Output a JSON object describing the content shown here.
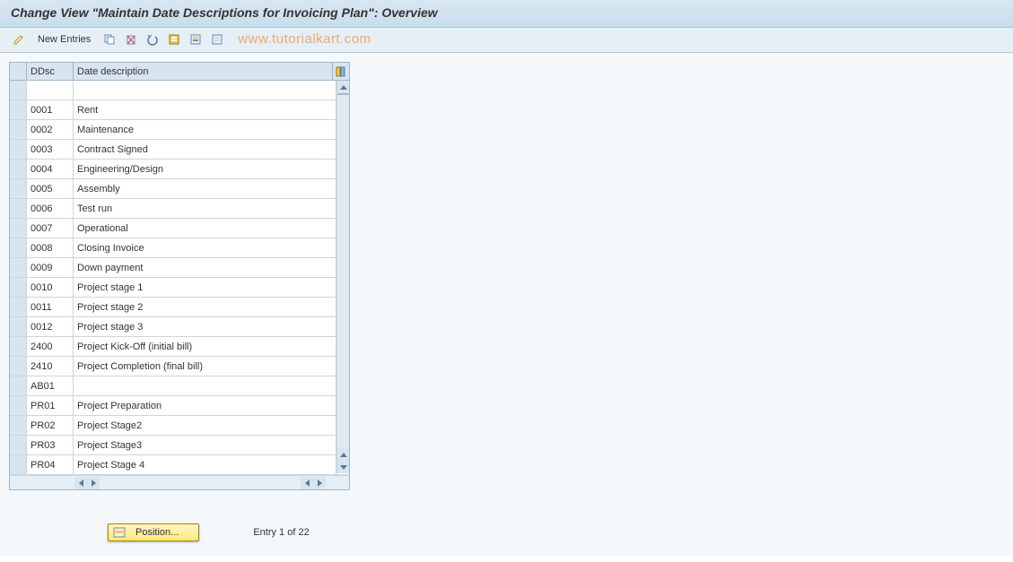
{
  "title": "Change View \"Maintain Date Descriptions for Invoicing Plan\": Overview",
  "toolbar": {
    "new_entries": "New Entries"
  },
  "watermark": "www.tutorialkart.com",
  "grid": {
    "headers": {
      "ddsc": "DDsc",
      "desc": "Date description"
    },
    "rows": [
      {
        "ddsc": "",
        "desc": ""
      },
      {
        "ddsc": "0001",
        "desc": "Rent"
      },
      {
        "ddsc": "0002",
        "desc": "Maintenance"
      },
      {
        "ddsc": "0003",
        "desc": "Contract Signed"
      },
      {
        "ddsc": "0004",
        "desc": "Engineering/Design"
      },
      {
        "ddsc": "0005",
        "desc": "Assembly"
      },
      {
        "ddsc": "0006",
        "desc": "Test run"
      },
      {
        "ddsc": "0007",
        "desc": "Operational"
      },
      {
        "ddsc": "0008",
        "desc": "Closing Invoice"
      },
      {
        "ddsc": "0009",
        "desc": "Down payment"
      },
      {
        "ddsc": "0010",
        "desc": "Project stage 1"
      },
      {
        "ddsc": "0011",
        "desc": "Project stage 2"
      },
      {
        "ddsc": "0012",
        "desc": "Project stage 3"
      },
      {
        "ddsc": "2400",
        "desc": "Project Kick-Off (initial bill)"
      },
      {
        "ddsc": "2410",
        "desc": "Project Completion (final bill)"
      },
      {
        "ddsc": "AB01",
        "desc": ""
      },
      {
        "ddsc": "PR01",
        "desc": "Project Preparation"
      },
      {
        "ddsc": "PR02",
        "desc": "Project Stage2"
      },
      {
        "ddsc": "PR03",
        "desc": "Project Stage3"
      },
      {
        "ddsc": "PR04",
        "desc": "Project Stage 4"
      }
    ]
  },
  "footer": {
    "position_label": "Position...",
    "entry_text": "Entry 1 of 22"
  }
}
